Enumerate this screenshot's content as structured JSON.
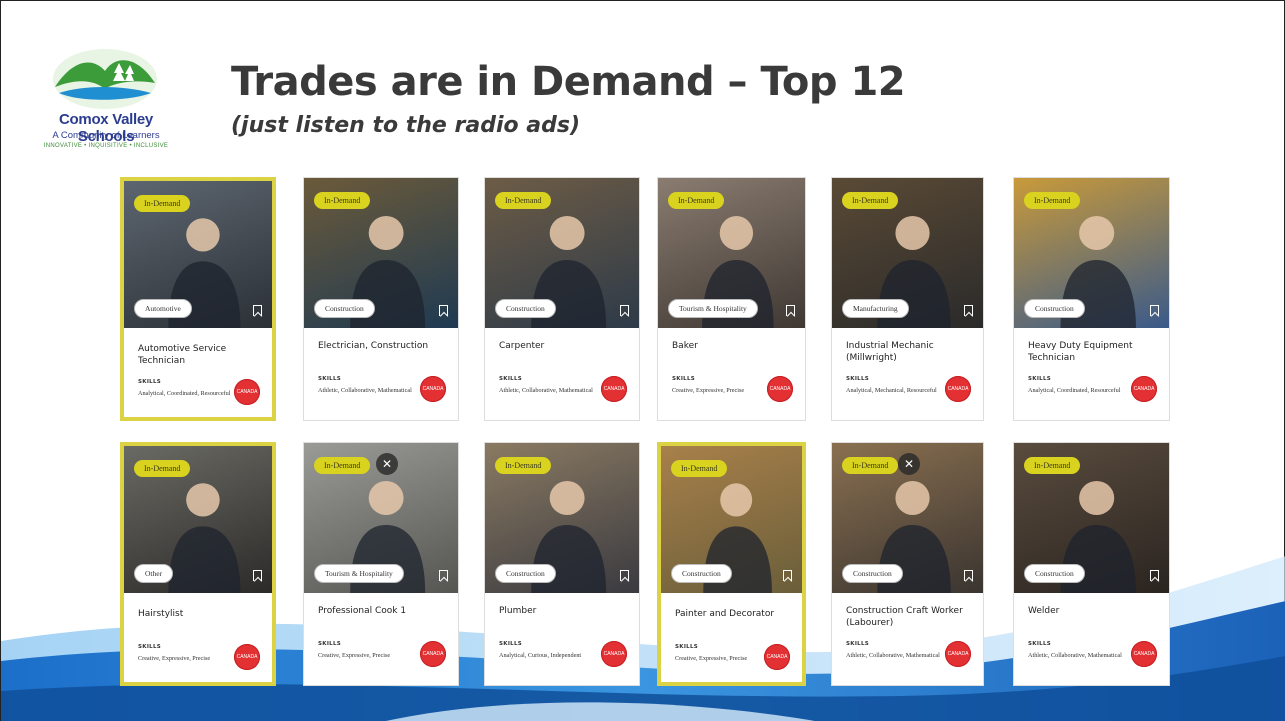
{
  "logo": {
    "name": "Comox Valley Schools",
    "tagline": "A Community of Learners",
    "motto": "INNOVATIVE • INQUISITIVE • INCLUSIVE"
  },
  "title": "Trades are in Demand – Top 12",
  "subtitle": "(just listen to the radio ads)",
  "skills_label": "SKILLS",
  "badge_label": "CANADA",
  "cards": [
    {
      "pill": "In-Demand",
      "category": "Automotive",
      "title": "Automotive Service Technician",
      "skills": "Analytical, Coordinated, Resourceful",
      "highlight": true,
      "close": false
    },
    {
      "pill": "In-Demand",
      "category": "Construction",
      "title": "Electrician, Construction",
      "skills": "Athletic, Collaborative, Mathematical",
      "highlight": false,
      "close": false
    },
    {
      "pill": "In-Demand",
      "category": "Construction",
      "title": "Carpenter",
      "skills": "Athletic, Collaborative, Mathematical",
      "highlight": false,
      "close": false
    },
    {
      "pill": "In-Demand",
      "category": "Tourism & Hospitality",
      "title": "Baker",
      "skills": "Creative, Expressive, Precise",
      "highlight": false,
      "close": false
    },
    {
      "pill": "In-Demand",
      "category": "Manufacturing",
      "title": "Industrial Mechanic (Millwright)",
      "skills": "Analytical, Mechanical, Resourceful",
      "highlight": false,
      "close": false
    },
    {
      "pill": "In-Demand",
      "category": "Construction",
      "title": "Heavy Duty Equipment Technician",
      "skills": "Analytical, Coordinated, Resourceful",
      "highlight": false,
      "close": false
    },
    {
      "pill": "In-Demand",
      "category": "Other",
      "title": "Hairstylist",
      "skills": "Creative, Expressive, Precise",
      "highlight": true,
      "close": false
    },
    {
      "pill": "In-Demand",
      "category": "Tourism & Hospitality",
      "title": "Professional Cook 1",
      "skills": "Creative, Expressive, Precise",
      "highlight": false,
      "close": true
    },
    {
      "pill": "In-Demand",
      "category": "Construction",
      "title": "Plumber",
      "skills": "Analytical, Curious, Independent",
      "highlight": false,
      "close": false
    },
    {
      "pill": "In-Demand",
      "category": "Construction",
      "title": "Painter and Decorator",
      "skills": "Creative, Expressive, Precise",
      "highlight": true,
      "close": false
    },
    {
      "pill": "In-Demand",
      "category": "Construction",
      "title": "Construction Craft Worker (Labourer)",
      "skills": "Athletic, Collaborative, Mathematical",
      "highlight": false,
      "close": true
    },
    {
      "pill": "In-Demand",
      "category": "Construction",
      "title": "Welder",
      "skills": "Athletic, Collaborative, Mathematical",
      "highlight": false,
      "close": false
    }
  ],
  "colors": {
    "pill": "#d9d21e",
    "highlight_border": "#dcd344",
    "badge": "#e23033",
    "logo_text": "#2c3d8f",
    "wave_blue": "#2b7fd4"
  }
}
